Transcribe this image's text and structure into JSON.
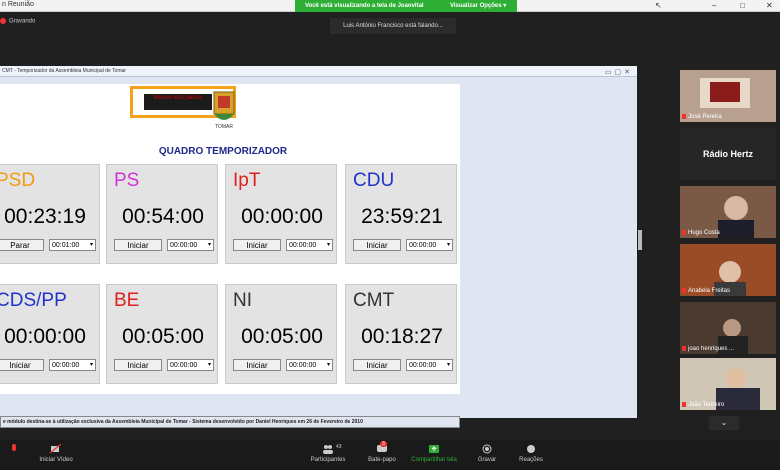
{
  "titlebar": {
    "app_title": "n Reunião",
    "share_message": "Você está visualizando a tela de Joaovital",
    "view_options": "Visualizar Opções"
  },
  "meeting": {
    "recording": "Gravando",
    "speaking": "Luis António Francisco está falando..."
  },
  "shared_window": {
    "title": "CMT - Temporizador da Assembleia Municipal de Tomar",
    "board_title": "QUADRO TEMPORIZADOR",
    "logo_text_1": "Moove este janela",
    "logo_text_2": "TOMAR",
    "footer": "e módulo destina-se à utilização exclusiva da Assembleia Municipal de Tomar - Sistema desenvolvido por Daniel Henriques em 26 de Fevereiro de 2010",
    "parties": [
      {
        "name": "PSD",
        "time": "00:23:19",
        "button": "Parar",
        "select": "00:01:00",
        "color": "#f39c12"
      },
      {
        "name": "PS",
        "time": "00:54:00",
        "button": "Iniciar",
        "select": "00:00:00",
        "color": "#d633d6"
      },
      {
        "name": "IpT",
        "time": "00:00:00",
        "button": "Iniciar",
        "select": "00:00:00",
        "color": "#e02020"
      },
      {
        "name": "CDU",
        "time": "23:59:21",
        "button": "Iniciar",
        "select": "00:00:00",
        "color": "#2233cc"
      },
      {
        "name": "CDS/PP",
        "time": "00:00:00",
        "button": "Iniciar",
        "select": "00:00:00",
        "color": "#2233cc"
      },
      {
        "name": "BE",
        "time": "00:05:00",
        "button": "Iniciar",
        "select": "00:00:00",
        "color": "#e02020"
      },
      {
        "name": "NI",
        "time": "00:05:00",
        "button": "Iniciar",
        "select": "00:00:00",
        "color": "#333333"
      },
      {
        "name": "CMT",
        "time": "00:18:27",
        "button": "Iniciar",
        "select": "00:00:00",
        "color": "#333333"
      }
    ]
  },
  "participants": [
    {
      "name": "José Pereira"
    },
    {
      "name": "Rádio Hertz"
    },
    {
      "name": "Hugo Costa"
    },
    {
      "name": "Anabela Freitas"
    },
    {
      "name": "joao henriques ..."
    },
    {
      "name": "João Tenreiro"
    }
  ],
  "toolbar": {
    "video": "Iniciar Vídeo",
    "participants": "Participantes",
    "participants_count": "43",
    "chat": "Bate-papo",
    "chat_badge": "3",
    "share": "Compartilhar tela",
    "record": "Gravar",
    "reactions": "Reações"
  }
}
